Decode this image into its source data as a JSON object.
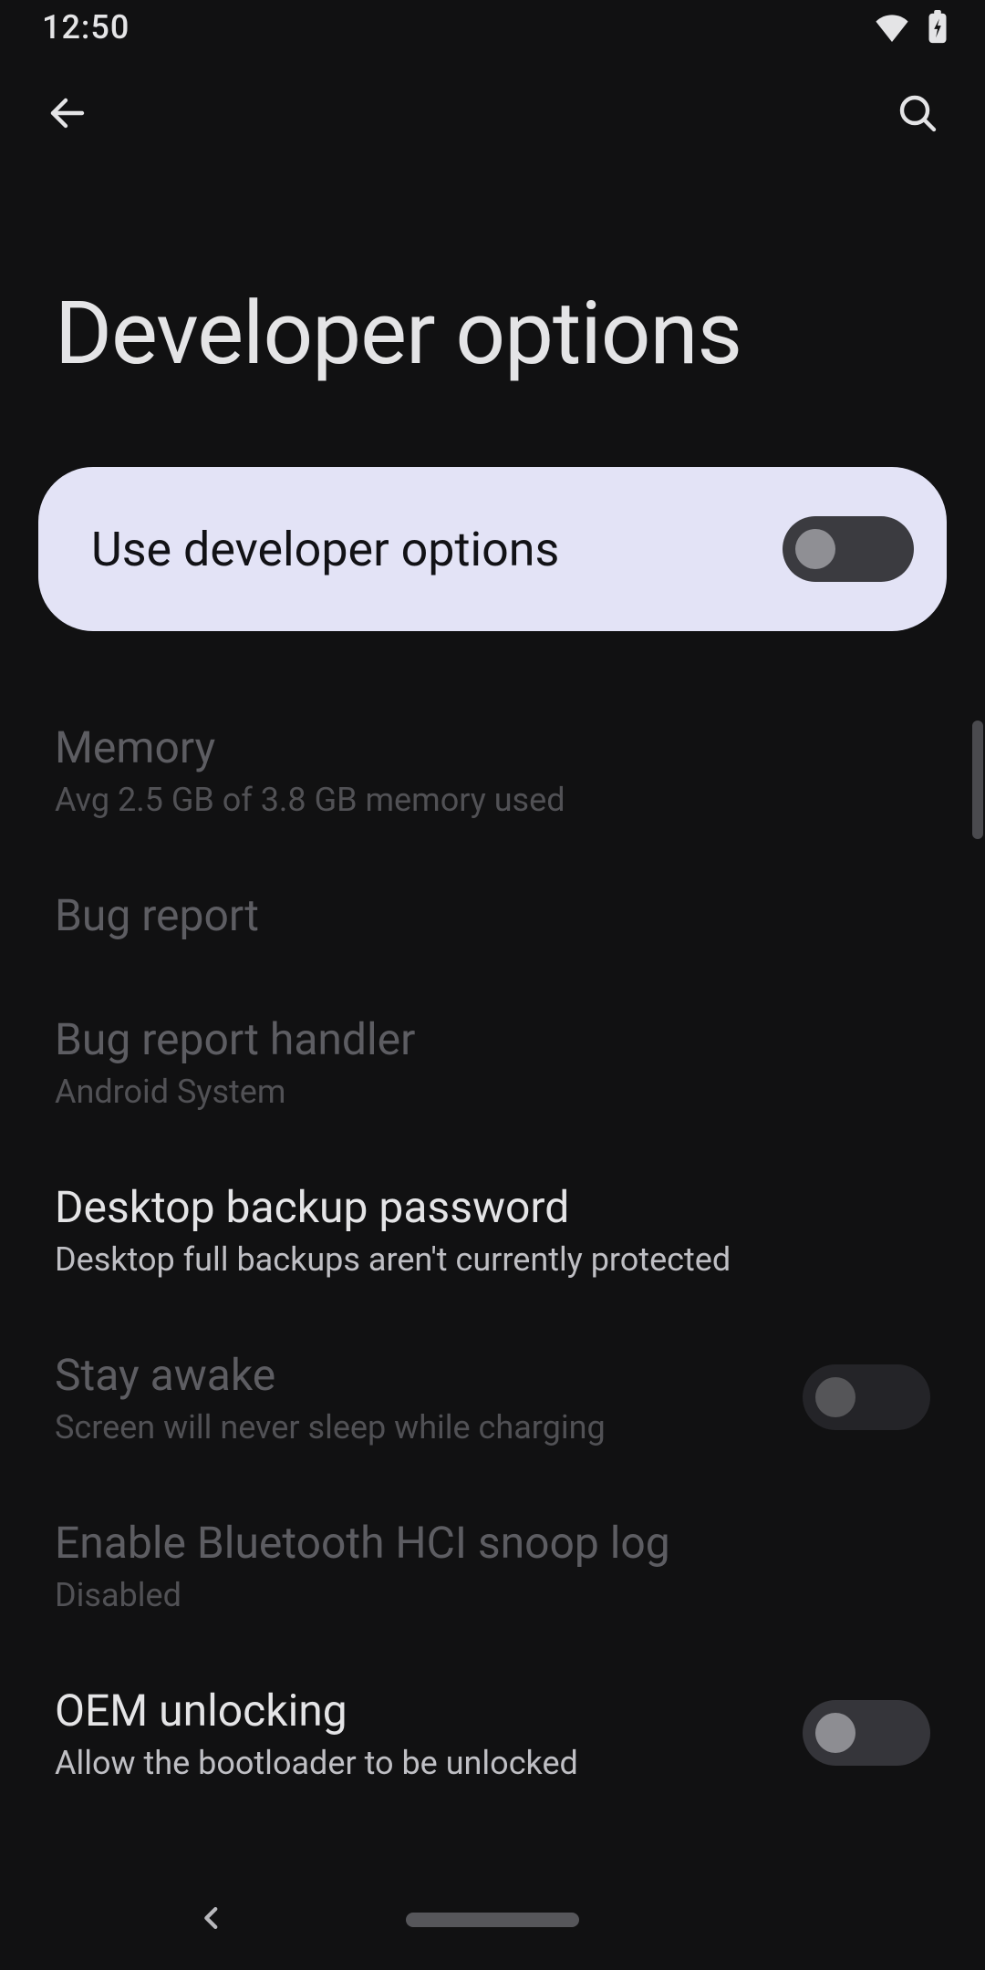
{
  "status": {
    "time": "12:50"
  },
  "page": {
    "title": "Developer options"
  },
  "master": {
    "label": "Use developer options",
    "enabled": false
  },
  "items": [
    {
      "id": "memory",
      "title": "Memory",
      "subtitle": "Avg 2.5 GB of 3.8 GB memory used",
      "enabled": false,
      "has_switch": false
    },
    {
      "id": "bug-report",
      "title": "Bug report",
      "subtitle": "",
      "enabled": false,
      "has_switch": false
    },
    {
      "id": "bug-handler",
      "title": "Bug report handler",
      "subtitle": "Android System",
      "enabled": false,
      "has_switch": false
    },
    {
      "id": "desktop-backup",
      "title": "Desktop backup password",
      "subtitle": "Desktop full backups aren't currently protected",
      "enabled": true,
      "has_switch": false
    },
    {
      "id": "stay-awake",
      "title": "Stay awake",
      "subtitle": "Screen will never sleep while charging",
      "enabled": false,
      "has_switch": true,
      "switch_on": false
    },
    {
      "id": "bt-hci",
      "title": "Enable Bluetooth HCI snoop log",
      "subtitle": "Disabled",
      "enabled": false,
      "has_switch": false
    },
    {
      "id": "oem-unlock",
      "title": "OEM unlocking",
      "subtitle": "Allow the bootloader to be unlocked",
      "enabled": true,
      "has_switch": true,
      "switch_on": false
    }
  ]
}
